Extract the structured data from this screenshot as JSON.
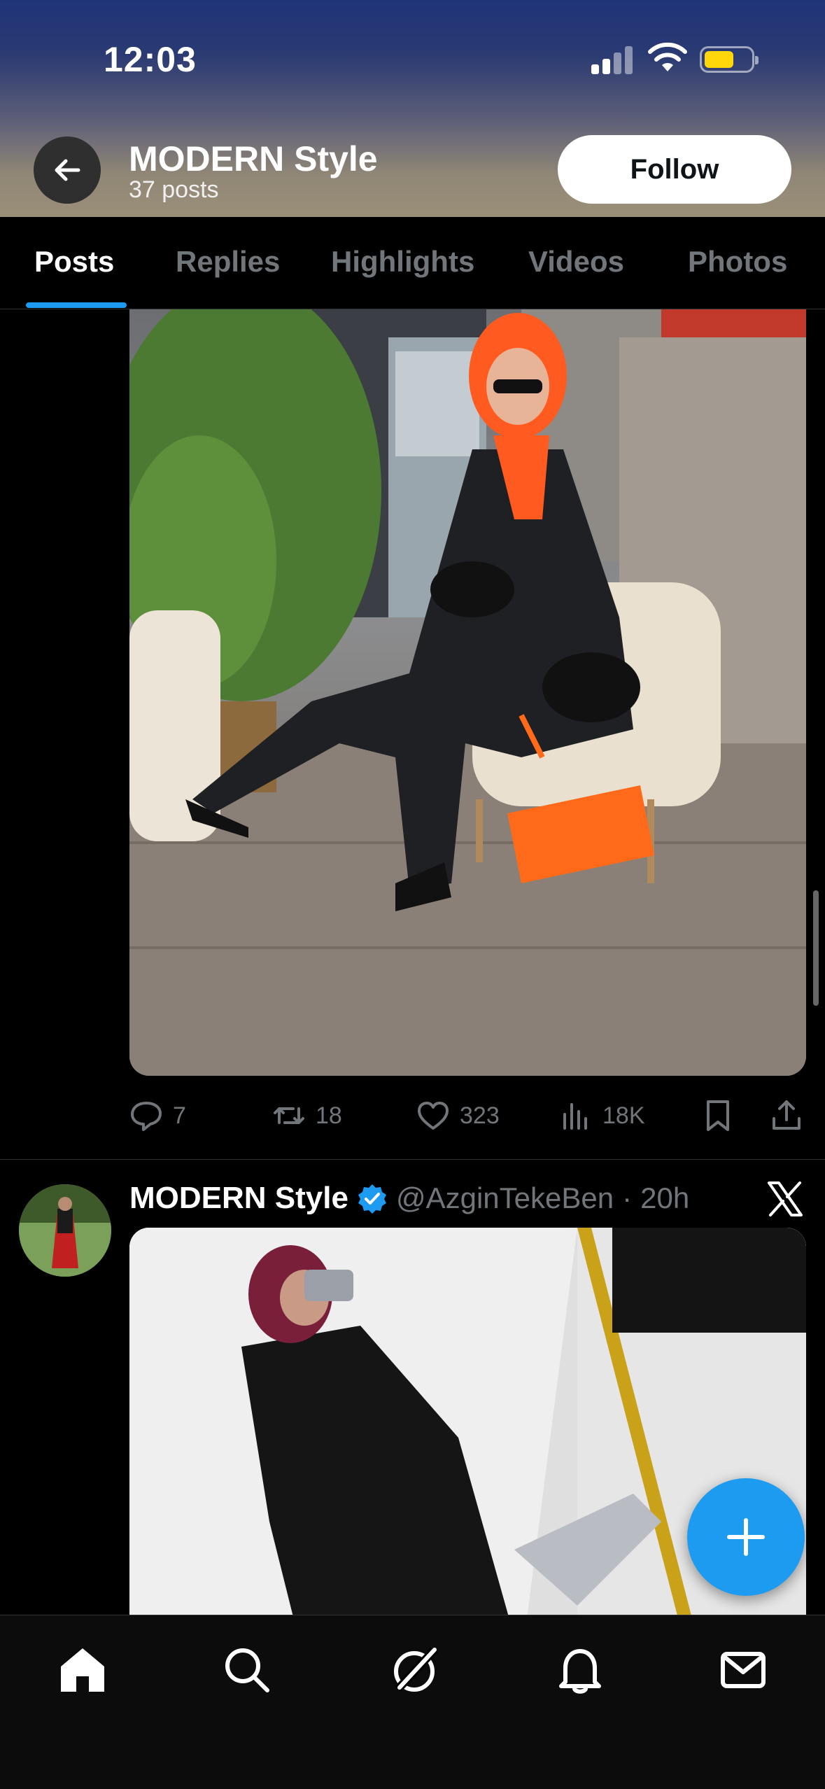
{
  "status_bar": {
    "time": "12:03",
    "signal_bars_active": 2,
    "signal_bars_total": 4,
    "battery_level": 0.64,
    "battery_color": "#ffd60a"
  },
  "profile": {
    "name": "MODERN Style",
    "post_count": "37 posts",
    "follow_label": "Follow"
  },
  "tabs": [
    {
      "label": "Posts",
      "active": true
    },
    {
      "label": "Replies",
      "active": false
    },
    {
      "label": "Highlights",
      "active": false
    },
    {
      "label": "Videos",
      "active": false
    },
    {
      "label": "Photos",
      "active": false
    }
  ],
  "posts": [
    {
      "media_icon": "photo-woman-in-black-outfit-orange-hijab",
      "stats": {
        "replies": "7",
        "reposts": "18",
        "likes": "323",
        "views": "18K"
      }
    },
    {
      "author_name": "MODERN Style",
      "verified": true,
      "handle": "@AzginTekeBen",
      "separator": "·",
      "time": "20h",
      "media_icon": "photo-mirror-selfie-black-dress"
    }
  ],
  "colors": {
    "accent": "#1d9bf0",
    "secondary_text": "#71767b",
    "background": "#000000"
  },
  "bottom_nav": [
    "home-icon",
    "search-icon",
    "grok-icon",
    "notifications-icon",
    "messages-icon"
  ]
}
